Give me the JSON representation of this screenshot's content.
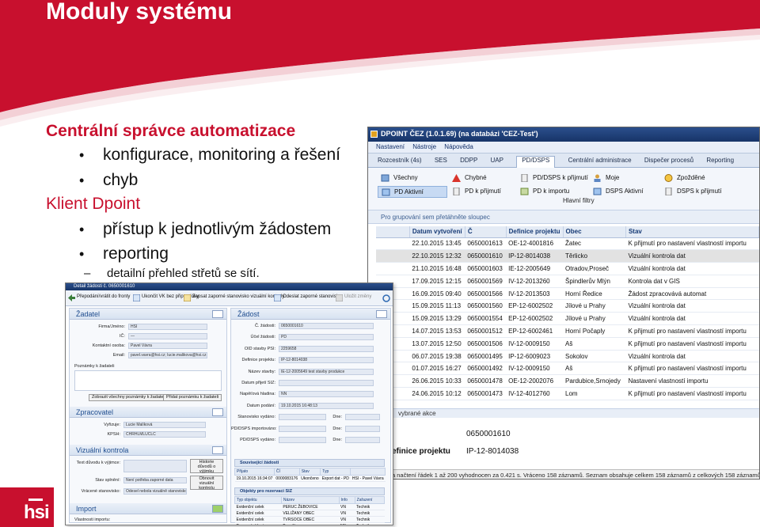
{
  "slide": {
    "title": "Moduly systému",
    "section1_heading": "Centrální správce automatizace",
    "section1_bullet": "konfigurace, monitoring a řešení",
    "section1_bullet_cont": "chyb",
    "section2_heading": "Klient Dpoint",
    "section2_bullets": [
      "přístup k jednotlivým žádostem",
      "reporting"
    ],
    "section2_sub": "detailní přehled střetů se sítí.",
    "bullet_glyph": "•",
    "dash_glyph": "–",
    "logo_text": "hsi",
    "colors": {
      "brand_red": "#c8102e",
      "window_blue": "#1f3f7a"
    }
  },
  "app_list": {
    "window_title": "DPOINT ČEZ (1.0.1.69) (na databázi 'CEZ-Test')",
    "menu": [
      "Nastavení",
      "Nástroje",
      "Nápověda"
    ],
    "tabs": [
      "Rozcestník (4s)",
      "SES",
      "DDPP",
      "UAP",
      "PD/DSPS",
      "Centrální administrace",
      "Dispečer procesů",
      "Reporting"
    ],
    "active_tab": "PD/DSPS",
    "ribbon_row1": [
      "Všechny",
      "Chybné",
      "PD/DSPS k přijmutí",
      "Moje",
      "Zpožděné"
    ],
    "ribbon_row2": [
      "PD Aktivní",
      "PD k přijmutí",
      "PD k importu",
      "DSPS Aktivní",
      "DSPS k přijmutí"
    ],
    "filters_label": "Hlavní filtry",
    "group_hint": "Pro grupování sem přetáhněte sloupec",
    "columns": [
      "Datum vytvoření",
      "Č",
      "Definice projektu",
      "Obec",
      "Stav"
    ],
    "rows": [
      [
        "22.10.2015 13:45",
        "0650001613",
        "OE-12-4001816",
        "Žatec",
        "K přijmutí pro nastavení vlastností importu"
      ],
      [
        "22.10.2015 12:32",
        "0650001610",
        "IP-12-8014038",
        "Těrlicko",
        "Vizuální kontrola dat"
      ],
      [
        "21.10.2015 16:48",
        "0650001603",
        "IE-12-2005649",
        "Otradov,Proseč",
        "Vizuální kontrola dat"
      ],
      [
        "17.09.2015 12:15",
        "0650001569",
        "IV-12-2013260",
        "Špindlerův Mlýn",
        "Kontrola dat v GIS"
      ],
      [
        "16.09.2015 09:40",
        "0650001566",
        "IV-12-2013503",
        "Horní Ředice",
        "Žádost zpracovává automat"
      ],
      [
        "15.09.2015 11:13",
        "0650001560",
        "EP-12-6002502",
        "Jílové u Prahy",
        "Vizuální kontrola dat"
      ],
      [
        "15.09.2015 13:29",
        "0650001554",
        "EP-12-6002502",
        "Jílové u Prahy",
        "Vizuální kontrola dat"
      ],
      [
        "14.07.2015 13:53",
        "0650001512",
        "EP-12-6002461",
        "Horní Počaply",
        "K přijmutí pro nastavení vlastností importu"
      ],
      [
        "13.07.2015 12:50",
        "0650001506",
        "IV-12-0009150",
        "Aš",
        "K přijmutí pro nastavení vlastností importu"
      ],
      [
        "06.07.2015 19:38",
        "0650001495",
        "IP-12-6009023",
        "Sokolov",
        "Vizuální kontrola dat"
      ],
      [
        "01.07.2015 16:27",
        "0650001492",
        "IV-12-0009150",
        "Aš",
        "K přijmutí pro nastavení vlastností importu"
      ],
      [
        "26.06.2015 10:33",
        "0650001478",
        "OE-12-2002076",
        "Pardubice,Srnojedy",
        "Nastavení vlastností importu"
      ],
      [
        "24.06.2015 10:12",
        "0650001473",
        "IV-12-4012760",
        "Lom",
        "K přijmutí pro nastavení vlastností importu"
      ]
    ],
    "highlight_row": 1,
    "selected_actions_label": "vybrané akce",
    "detail_number": "0650001610",
    "detail_label": "efinice projektu",
    "detail_value": "IP-12-8014038",
    "status_text": "a načtení řádek 1 až 200 vyhodnocen za 0.421 s. Vráceno 158 záznamů. Seznam obsahuje celkem 158 záznamů z celkových 158 záznamů"
  },
  "app_detail": {
    "window_title": "Detail žádosti č. 0650001610",
    "toolbar": [
      "Přepodání/vrátit do fronty",
      "Ukončit VK bez připomínky",
      "Zapsat zaporné stanovisko vizuální kontroly",
      "Odeslat zaporné stanovisko",
      "Uložit změny"
    ],
    "zadatel": {
      "title": "Žadatel",
      "fields": [
        {
          "label": "Firma/Jméno:",
          "value": "HSI"
        },
        {
          "label": "IČ:",
          "value": "—"
        },
        {
          "label": "Kontaktní osoba:",
          "value": "Pavel Vávra"
        },
        {
          "label": "Email:",
          "value": "pavel.vavra@hsi.cz; lucie.malikova@hsi.cz"
        }
      ],
      "notes_label": "Poznámky k žadateli",
      "btn_show": "Zobrazit všechny poznámky k žadateli",
      "btn_add": "Přidat poznámku k žadateli"
    },
    "zpracovatel": {
      "title": "Zpracovatel",
      "fields": [
        {
          "label": "Vyřizuje:",
          "value": "Lucie Malíková"
        },
        {
          "label": "KPSH:",
          "value": "CHRHLMLUCLC"
        }
      ]
    },
    "kontrola": {
      "title": "Vizuální kontrola",
      "fields": [
        {
          "label": "Text důvodu k výjimce:",
          "value": ""
        },
        {
          "label": "Stav splnění:",
          "value": "Není potřeba zaporné data"
        },
        {
          "label": "Vrácené stanovisko:",
          "value": "Odesel nebola vizuálně stanovisko"
        }
      ],
      "btn_history": "Historie důvodů o výjimku",
      "btn_refresh": "Obnovit vizuální kontrolu"
    },
    "import": {
      "title": "Import",
      "fields": [
        {
          "label": "Vlastnosti importu:",
          "value": ""
        }
      ]
    },
    "zadost": {
      "title": "Žádost",
      "fields": [
        {
          "label": "Č. žádosti:",
          "value": "0650001610"
        },
        {
          "label": "Účel žádosti:",
          "value": "PD"
        },
        {
          "label": "OID stavby PSI:",
          "value": "2259658"
        },
        {
          "label": "Definice projektu:",
          "value": "IP-12-8014038"
        },
        {
          "label": "Název stavby:",
          "value": "IE-12-2005649 test stavby produkce"
        },
        {
          "label": "Datum přijetí SIZ:",
          "value": ""
        },
        {
          "label": "Napěťová hladina:",
          "value": "NN"
        },
        {
          "label": "Datum podání:",
          "value": "19.10.2015 16:48:13"
        },
        {
          "label": "Stanovisko vydáno:",
          "value": ""
        },
        {
          "label": "PD/DSPS importováno:",
          "value": ""
        },
        {
          "label": "PD/DSPS vydáno:",
          "value": ""
        }
      ],
      "side_label": "Dne:"
    },
    "related": {
      "title": "Související žádosti",
      "columns": [
        "Přijato",
        "ČÍ",
        "Stav",
        "Typ"
      ],
      "row": [
        "19.10.2015 16:34:07",
        "0000083176",
        "Ukončeno",
        "Export dat - PD",
        "HSI - Pavel Vávra"
      ]
    },
    "objects": {
      "title": "Objekty pro rezervaci SIZ",
      "columns": [
        "Typ objektu",
        "Název",
        "Info",
        "Zařazení"
      ],
      "rows": [
        [
          "Evidenční celek",
          "PERUC ŽEBOVICE",
          "VN",
          "Technik"
        ],
        [
          "Evidenční celek",
          "VELIŽANY OBEC",
          "VN",
          "Technik"
        ],
        [
          "Evidenční celek",
          "TVRSOCE OBEC",
          "VN",
          "Technik"
        ],
        [
          "Provozní oblast",
          "Beneška",
          "NN",
          "Technik"
        ]
      ]
    }
  }
}
